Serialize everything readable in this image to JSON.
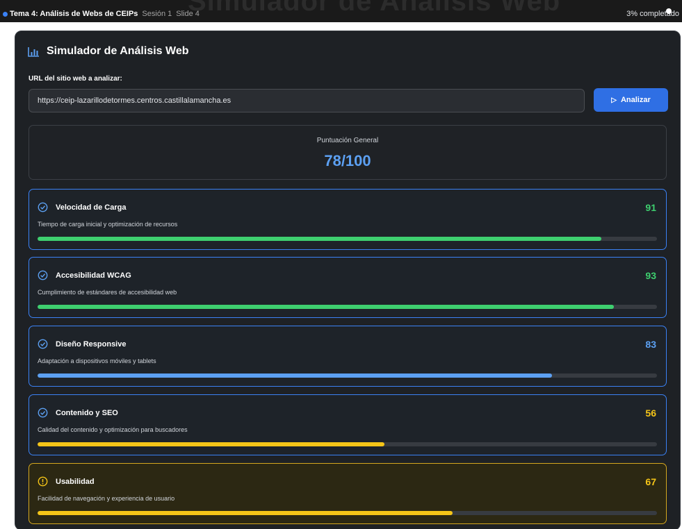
{
  "topbar": {
    "course": "Tema 4: Análisis de Webs de CEIPs",
    "session": "Sesión 1",
    "slide": "Slide 4",
    "progress_text": "3% completado",
    "ghost_title": "Simulador de Análisis Web"
  },
  "header": {
    "title": "Simulador de Análisis Web",
    "icon": "bar-chart-icon"
  },
  "url": {
    "label": "URL del sitio web a analizar:",
    "value": "https://ceip-lazarillodetormes.centros.castillalamancha.es"
  },
  "analyze_button": {
    "label": "Analizar",
    "icon": "play-icon"
  },
  "overall": {
    "label": "Puntuación General",
    "value": "78/100"
  },
  "colors": {
    "green": "#3ecf6f",
    "blue": "#5ca0f2",
    "yellow": "#f5c518",
    "accent": "#2f6fe4"
  },
  "metrics": [
    {
      "title": "Velocidad de Carga",
      "description": "Tiempo de carga inicial y optimización de recursos",
      "score": 91,
      "fill": 0.91,
      "color": "green",
      "icon": "check-circle-icon",
      "status": "ok"
    },
    {
      "title": "Accesibilidad WCAG",
      "description": "Cumplimiento de estándares de accesibilidad web",
      "score": 93,
      "fill": 0.93,
      "color": "green",
      "icon": "check-circle-icon",
      "status": "ok"
    },
    {
      "title": "Diseño Responsive",
      "description": "Adaptación a dispositivos móviles y tablets",
      "score": 83,
      "fill": 0.83,
      "color": "blue",
      "icon": "check-circle-icon",
      "status": "ok"
    },
    {
      "title": "Contenido y SEO",
      "description": "Calidad del contenido y optimización para buscadores",
      "score": 56,
      "fill": 0.56,
      "color": "yellow",
      "icon": "check-circle-icon",
      "status": "ok"
    },
    {
      "title": "Usabilidad",
      "description": "Facilidad de navegación y experiencia de usuario",
      "score": 67,
      "fill": 0.67,
      "color": "yellow",
      "icon": "alert-circle-icon",
      "status": "warning"
    }
  ]
}
